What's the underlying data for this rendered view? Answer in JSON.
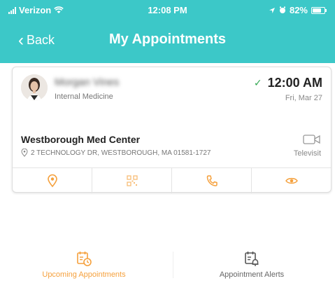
{
  "status_bar": {
    "carrier": "Verizon",
    "time": "12:08 PM",
    "battery_percent": "82%",
    "battery_level": 0.82,
    "icons": [
      "signal-icon",
      "wifi-icon",
      "location-icon",
      "alarm-icon",
      "battery-icon"
    ]
  },
  "nav": {
    "back_label": "Back",
    "title": "My Appointments"
  },
  "appointment": {
    "provider_name": "Morgan Vines",
    "specialty": "Internal Medicine",
    "time": "12:00 AM",
    "date": "Fri, Mar 27",
    "facility": "Westborough Med Center",
    "address": "2 TECHNOLOGY DR, WESTBOROUGH, MA 01581-1727",
    "visit_type": "Televisit",
    "actions": [
      "location-pin-icon",
      "qr-code-icon",
      "phone-icon",
      "eye-icon"
    ]
  },
  "tabs": [
    {
      "label": "Upcoming Appointments",
      "icon": "calendar-clock-icon",
      "active": true
    },
    {
      "label": "Appointment Alerts",
      "icon": "calendar-bell-icon",
      "active": false
    }
  ],
  "colors": {
    "header_teal": "#3cc8c8",
    "accent_orange": "#f5a03c",
    "check_green": "#34a853"
  }
}
